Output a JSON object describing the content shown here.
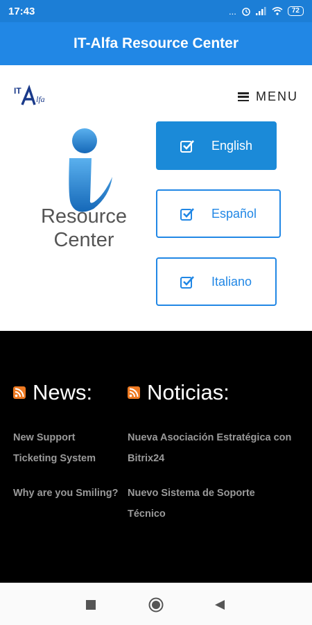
{
  "status_bar": {
    "time": "17:43",
    "battery": "72",
    "dots": "..."
  },
  "app_bar": {
    "title": "IT-Alfa Resource Center"
  },
  "header": {
    "logo_alt": "IT Alfa",
    "menu_label": "MENU"
  },
  "logo": {
    "line1": "Resource",
    "line2": "Center"
  },
  "languages": [
    {
      "label": "English",
      "active": true
    },
    {
      "label": "Español",
      "active": false
    },
    {
      "label": "Italiano",
      "active": false
    }
  ],
  "news": {
    "heading": "News:",
    "items": [
      "New Support Ticketing System",
      "Why are you Smiling?"
    ]
  },
  "noticias": {
    "heading": "Noticias:",
    "items": [
      "Nueva Asociación Estratégica con Bitrix24",
      "Nuevo Sistema de Soporte Técnico"
    ]
  },
  "colors": {
    "primary": "#2187e5",
    "active_button": "#1b8ad8",
    "rss": "#ee7a22",
    "link": "#9a9a9a"
  }
}
